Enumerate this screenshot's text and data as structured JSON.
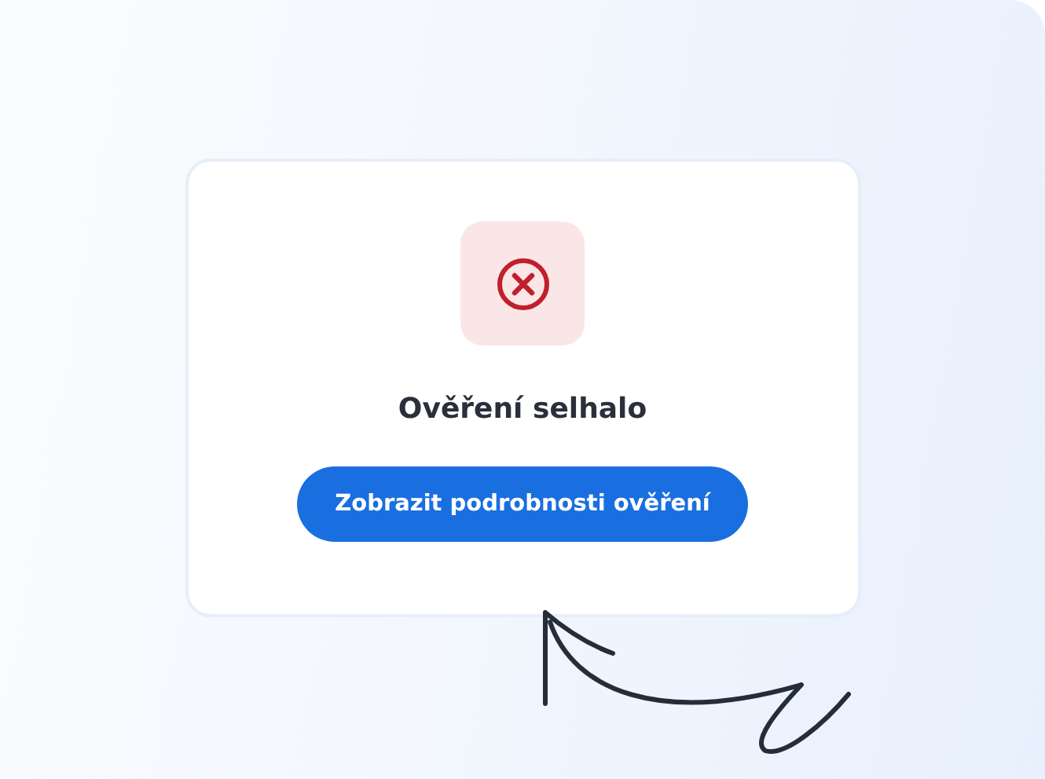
{
  "card": {
    "failed": true,
    "title": "Ověření selhalo",
    "button": "Zobrazit podrobnosti ověření"
  }
}
